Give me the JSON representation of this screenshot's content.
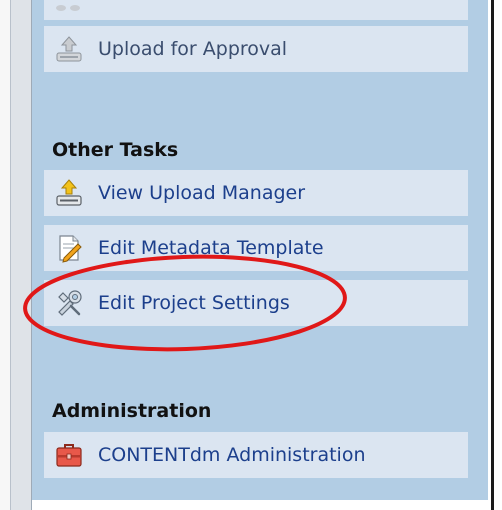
{
  "tasks": {
    "upload_for_approval": "Upload for Approval"
  },
  "other_tasks": {
    "heading": "Other Tasks",
    "items": [
      {
        "label": "View Upload Manager",
        "icon": "upload-manager-icon"
      },
      {
        "label": "Edit Metadata Template",
        "icon": "edit-template-icon"
      },
      {
        "label": "Edit Project Settings",
        "icon": "settings-tools-icon"
      }
    ]
  },
  "administration": {
    "heading": "Administration",
    "items": [
      {
        "label": "CONTENTdm Administration",
        "icon": "toolbox-icon"
      }
    ]
  },
  "colors": {
    "panel_bg": "#b2cde4",
    "row_bg": "#dbe5f1",
    "link": "#1c3f8c",
    "highlight_circle": "#e01818"
  }
}
